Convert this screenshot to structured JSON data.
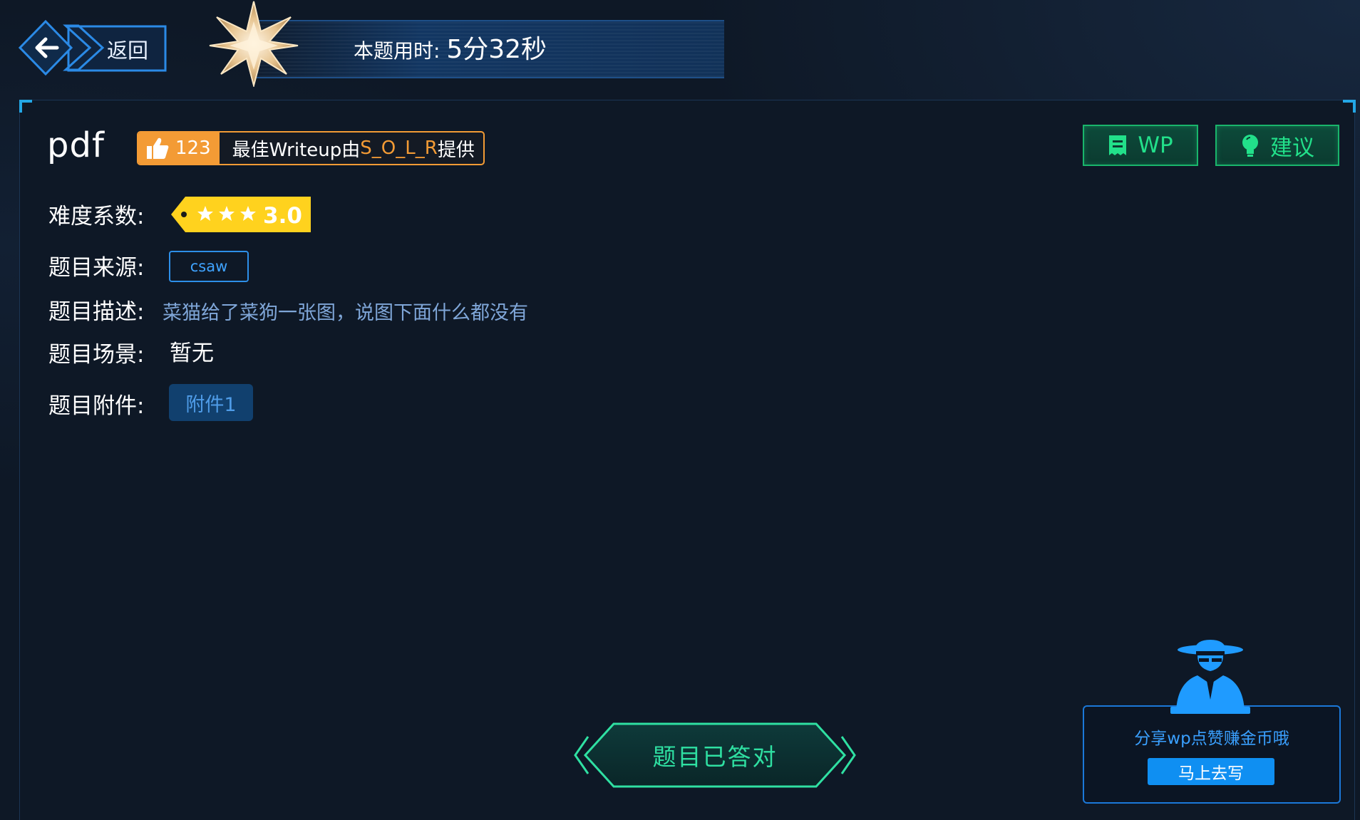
{
  "header": {
    "back_label": "返回",
    "timer_label": "本题用时: ",
    "timer_value": "5分32秒"
  },
  "challenge": {
    "title": "pdf",
    "likes": {
      "count": "123",
      "text_prefix": "最佳Writeup由",
      "author": "S_O_L_R",
      "text_suffix": "提供"
    },
    "actions": {
      "wp_label": "WP",
      "suggest_label": "建议"
    },
    "difficulty": {
      "label": "难度系数:",
      "stars": 3,
      "value": "3.0"
    },
    "source": {
      "label": "题目来源:",
      "value": "csaw"
    },
    "description": {
      "label": "题目描述:",
      "value": "菜猫给了菜狗一张图，说图下面什么都没有"
    },
    "scene": {
      "label": "题目场景:",
      "value": "暂无"
    },
    "attachments": {
      "label": "题目附件:",
      "items": [
        "附件1"
      ]
    },
    "status_label": "题目已答对"
  },
  "promo": {
    "text": "分享wp点赞赚金币哦",
    "button_label": "马上去写"
  },
  "colors": {
    "accent_blue": "#2d8fe8",
    "accent_green": "#22e08a",
    "accent_orange": "#f39b35",
    "difficulty_yellow": "#ffd21e"
  },
  "icons": {
    "back": "arrow-left-icon",
    "badge": "star-badge-icon",
    "like": "thumbs-up-icon",
    "wp": "document-icon",
    "suggest": "lightbulb-icon",
    "promo": "hacker-avatar-icon"
  }
}
